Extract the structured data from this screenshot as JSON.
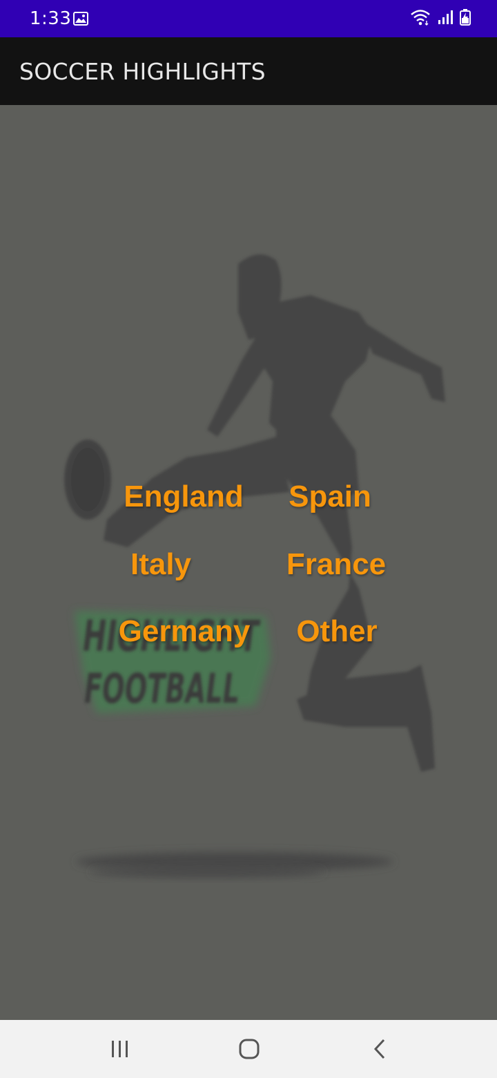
{
  "status_bar": {
    "time": "1:33",
    "icons": [
      "gallery-icon",
      "wifi-icon",
      "signal-icon",
      "battery-charging-icon"
    ],
    "color": "#3000b4"
  },
  "app_bar": {
    "title": "SOCCER HIGHLIGHTS",
    "color": "#121212"
  },
  "background": {
    "color": "#5d5e5a",
    "artwork": "soccer-player-kicking-ball",
    "logo_lines": [
      "HIGHLIGHT",
      "FOOTBALL"
    ]
  },
  "countries": [
    {
      "label": "England",
      "color": "#f7960c"
    },
    {
      "label": "Spain",
      "color": "#f7960c"
    },
    {
      "label": "Italy",
      "color": "#f7960c"
    },
    {
      "label": "France",
      "color": "#f7960c"
    },
    {
      "label": "Germany",
      "color": "#f7960c"
    },
    {
      "label": "Other",
      "color": "#f7960c"
    }
  ],
  "nav_bar": {
    "buttons": [
      "recent-apps-icon",
      "home-icon",
      "back-icon"
    ]
  }
}
